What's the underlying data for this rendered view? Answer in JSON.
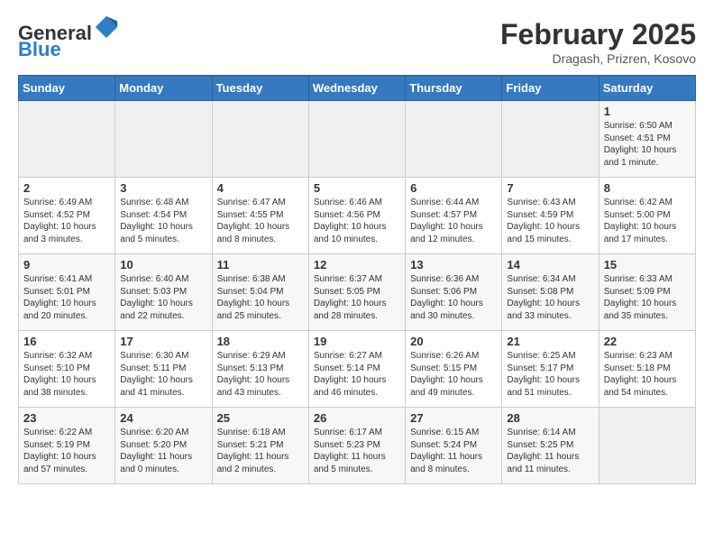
{
  "header": {
    "logo_general": "General",
    "logo_blue": "Blue",
    "month_year": "February 2025",
    "location": "Dragash, Prizren, Kosovo"
  },
  "days_of_week": [
    "Sunday",
    "Monday",
    "Tuesday",
    "Wednesday",
    "Thursday",
    "Friday",
    "Saturday"
  ],
  "weeks": [
    [
      {
        "day": "",
        "info": ""
      },
      {
        "day": "",
        "info": ""
      },
      {
        "day": "",
        "info": ""
      },
      {
        "day": "",
        "info": ""
      },
      {
        "day": "",
        "info": ""
      },
      {
        "day": "",
        "info": ""
      },
      {
        "day": "1",
        "info": "Sunrise: 6:50 AM\nSunset: 4:51 PM\nDaylight: 10 hours\nand 1 minute."
      }
    ],
    [
      {
        "day": "2",
        "info": "Sunrise: 6:49 AM\nSunset: 4:52 PM\nDaylight: 10 hours\nand 3 minutes."
      },
      {
        "day": "3",
        "info": "Sunrise: 6:48 AM\nSunset: 4:54 PM\nDaylight: 10 hours\nand 5 minutes."
      },
      {
        "day": "4",
        "info": "Sunrise: 6:47 AM\nSunset: 4:55 PM\nDaylight: 10 hours\nand 8 minutes."
      },
      {
        "day": "5",
        "info": "Sunrise: 6:46 AM\nSunset: 4:56 PM\nDaylight: 10 hours\nand 10 minutes."
      },
      {
        "day": "6",
        "info": "Sunrise: 6:44 AM\nSunset: 4:57 PM\nDaylight: 10 hours\nand 12 minutes."
      },
      {
        "day": "7",
        "info": "Sunrise: 6:43 AM\nSunset: 4:59 PM\nDaylight: 10 hours\nand 15 minutes."
      },
      {
        "day": "8",
        "info": "Sunrise: 6:42 AM\nSunset: 5:00 PM\nDaylight: 10 hours\nand 17 minutes."
      }
    ],
    [
      {
        "day": "9",
        "info": "Sunrise: 6:41 AM\nSunset: 5:01 PM\nDaylight: 10 hours\nand 20 minutes."
      },
      {
        "day": "10",
        "info": "Sunrise: 6:40 AM\nSunset: 5:03 PM\nDaylight: 10 hours\nand 22 minutes."
      },
      {
        "day": "11",
        "info": "Sunrise: 6:38 AM\nSunset: 5:04 PM\nDaylight: 10 hours\nand 25 minutes."
      },
      {
        "day": "12",
        "info": "Sunrise: 6:37 AM\nSunset: 5:05 PM\nDaylight: 10 hours\nand 28 minutes."
      },
      {
        "day": "13",
        "info": "Sunrise: 6:36 AM\nSunset: 5:06 PM\nDaylight: 10 hours\nand 30 minutes."
      },
      {
        "day": "14",
        "info": "Sunrise: 6:34 AM\nSunset: 5:08 PM\nDaylight: 10 hours\nand 33 minutes."
      },
      {
        "day": "15",
        "info": "Sunrise: 6:33 AM\nSunset: 5:09 PM\nDaylight: 10 hours\nand 35 minutes."
      }
    ],
    [
      {
        "day": "16",
        "info": "Sunrise: 6:32 AM\nSunset: 5:10 PM\nDaylight: 10 hours\nand 38 minutes."
      },
      {
        "day": "17",
        "info": "Sunrise: 6:30 AM\nSunset: 5:11 PM\nDaylight: 10 hours\nand 41 minutes."
      },
      {
        "day": "18",
        "info": "Sunrise: 6:29 AM\nSunset: 5:13 PM\nDaylight: 10 hours\nand 43 minutes."
      },
      {
        "day": "19",
        "info": "Sunrise: 6:27 AM\nSunset: 5:14 PM\nDaylight: 10 hours\nand 46 minutes."
      },
      {
        "day": "20",
        "info": "Sunrise: 6:26 AM\nSunset: 5:15 PM\nDaylight: 10 hours\nand 49 minutes."
      },
      {
        "day": "21",
        "info": "Sunrise: 6:25 AM\nSunset: 5:17 PM\nDaylight: 10 hours\nand 51 minutes."
      },
      {
        "day": "22",
        "info": "Sunrise: 6:23 AM\nSunset: 5:18 PM\nDaylight: 10 hours\nand 54 minutes."
      }
    ],
    [
      {
        "day": "23",
        "info": "Sunrise: 6:22 AM\nSunset: 5:19 PM\nDaylight: 10 hours\nand 57 minutes."
      },
      {
        "day": "24",
        "info": "Sunrise: 6:20 AM\nSunset: 5:20 PM\nDaylight: 11 hours\nand 0 minutes."
      },
      {
        "day": "25",
        "info": "Sunrise: 6:18 AM\nSunset: 5:21 PM\nDaylight: 11 hours\nand 2 minutes."
      },
      {
        "day": "26",
        "info": "Sunrise: 6:17 AM\nSunset: 5:23 PM\nDaylight: 11 hours\nand 5 minutes."
      },
      {
        "day": "27",
        "info": "Sunrise: 6:15 AM\nSunset: 5:24 PM\nDaylight: 11 hours\nand 8 minutes."
      },
      {
        "day": "28",
        "info": "Sunrise: 6:14 AM\nSunset: 5:25 PM\nDaylight: 11 hours\nand 11 minutes."
      },
      {
        "day": "",
        "info": ""
      }
    ]
  ]
}
